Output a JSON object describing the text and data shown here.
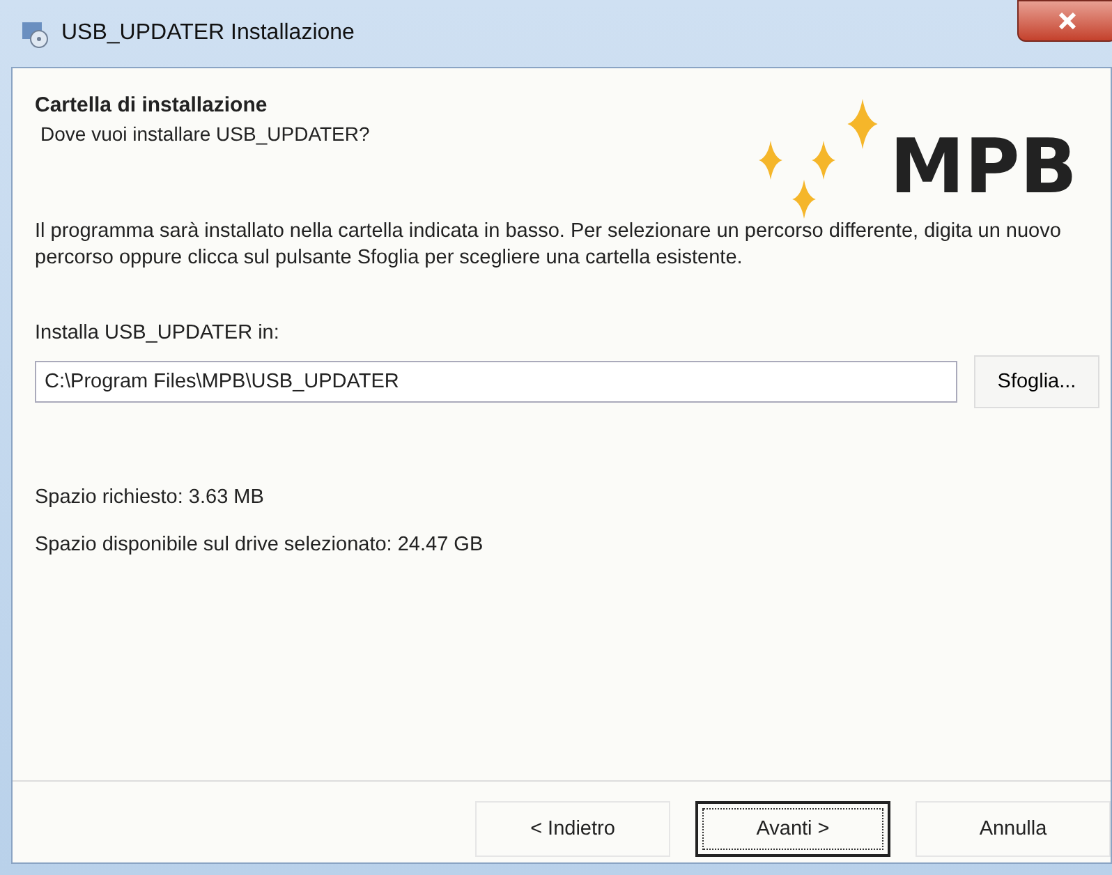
{
  "window": {
    "title": "USB_UPDATER Installazione"
  },
  "header": {
    "title": "Cartella di installazione",
    "subtitle": "Dove vuoi installare USB_UPDATER?",
    "logo": "MPB"
  },
  "description": "Il programma sarà installato nella cartella indicata in basso. Per selezionare un percorso differente, digita un nuovo percorso oppure clicca sul pulsante Sfoglia per scegliere una cartella esistente.",
  "install_label": "Installa USB_UPDATER in:",
  "path_field": {
    "value": "C:\\Program Files\\MPB\\USB_UPDATER"
  },
  "browse_button": "Sfoglia...",
  "space_required": "Spazio richiesto: 3.63 MB",
  "space_available": "Spazio disponibile sul drive selezionato: 24.47 GB",
  "buttons": [
    {
      "label": "< Indietro",
      "selected": false
    },
    {
      "label": "Avanti >",
      "selected": true
    },
    {
      "label": "Annulla",
      "selected": false
    }
  ]
}
